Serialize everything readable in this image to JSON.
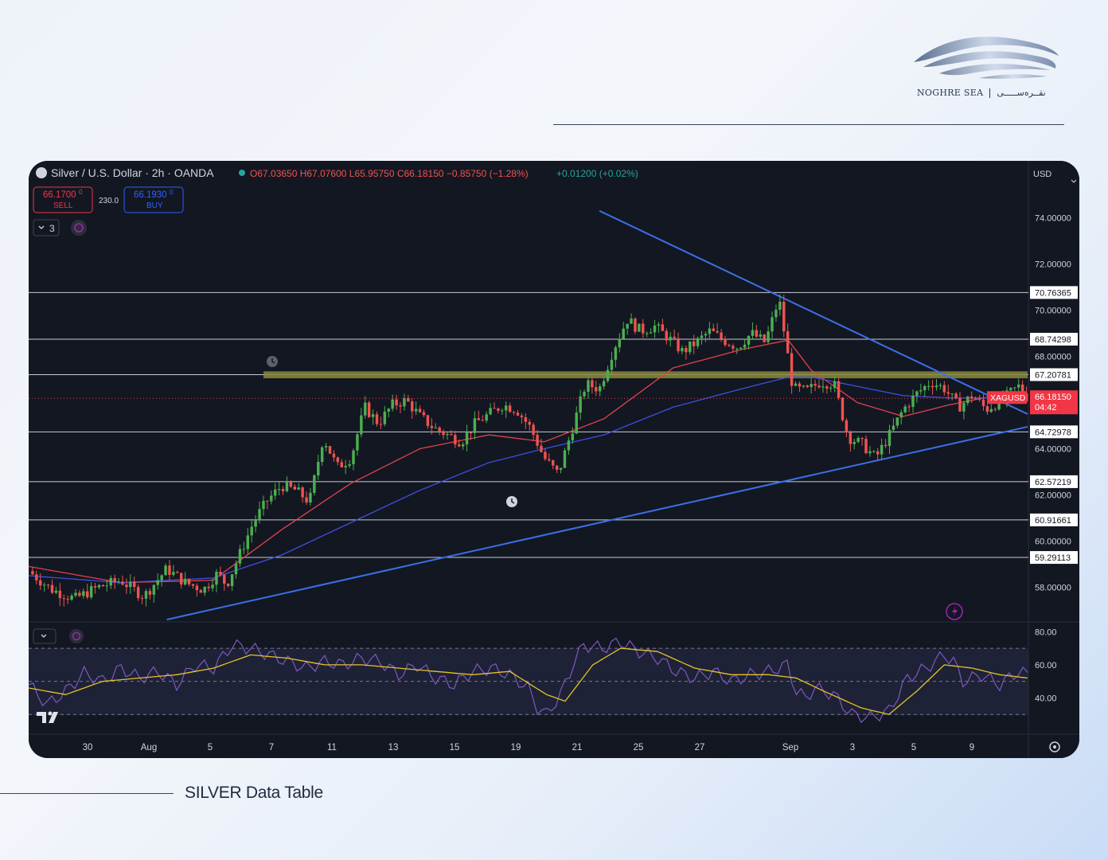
{
  "brand": {
    "latin": "NOGHRE SEA",
    "persian": "نقــره‌ســـــی"
  },
  "caption": "SILVER Data Table",
  "header": {
    "symbol_title": "Silver / U.S. Dollar · 2h · OANDA",
    "ohlc": "O67.03650 H67.07600 L65.95750 C66.18150 −0.85750 (−1.28%)",
    "change2": "+0.01200 (+0.02%)",
    "sell_price": "66.1700",
    "sell_sup": "0",
    "sell_label": "SELL",
    "spread": "230.0",
    "buy_price": "66.1930",
    "buy_sup": "0",
    "buy_label": "BUY",
    "indicator_count": "3",
    "currency": "USD"
  },
  "colors": {
    "bg": "#131722",
    "up": "#26a69a",
    "down": "#ef5350",
    "candle_up": "#4caf50",
    "ema_red": "#e0434b",
    "ema_blue": "#3d4fe0",
    "trendline": "#3b6fe6",
    "resistance_zone": "#8a8a3a",
    "rsi": "#7e57c2",
    "rsi_ma": "#e6c229",
    "last_price": "#f23645"
  },
  "chart_data": {
    "type": "candlestick",
    "title": "Silver / U.S. Dollar · 2h · OANDA",
    "ylim": [
      56.5,
      75.5
    ],
    "y_ticks": [
      "74.00000",
      "72.00000",
      "70.00000",
      "68.00000",
      "64.00000",
      "62.00000",
      "60.00000",
      "58.00000"
    ],
    "x_ticks": [
      "30",
      "Aug",
      "5",
      "7",
      "11",
      "13",
      "15",
      "19",
      "21",
      "25",
      "27",
      "Sep",
      "3",
      "5",
      "9"
    ],
    "horizontal_levels": [
      70.76365,
      68.74298,
      67.20781,
      64.72978,
      62.57219,
      60.91661,
      59.29113
    ],
    "level_labels": [
      "70.76365",
      "68.74298",
      "67.20781",
      "64.72978",
      "62.57219",
      "60.91661",
      "59.29113"
    ],
    "last_price": {
      "symbol": "XAGUSD",
      "value": "66.18150",
      "countdown": "04:42"
    },
    "price_path": [
      [
        0,
        58.7
      ],
      [
        5,
        57.9
      ],
      [
        10,
        57.5
      ],
      [
        15,
        58.0
      ],
      [
        20,
        58.3
      ],
      [
        25,
        57.6
      ],
      [
        30,
        58.8
      ],
      [
        34,
        58.2
      ],
      [
        38,
        57.9
      ],
      [
        41,
        58.6
      ],
      [
        43,
        58.1
      ],
      [
        46,
        59.5
      ],
      [
        49,
        60.9
      ],
      [
        52,
        61.8
      ],
      [
        55,
        62.4
      ],
      [
        58,
        62.2
      ],
      [
        61,
        61.7
      ],
      [
        64,
        64.5
      ],
      [
        67,
        63.2
      ],
      [
        70,
        63.6
      ],
      [
        73,
        65.8
      ],
      [
        76,
        65.1
      ],
      [
        79,
        65.9
      ],
      [
        82,
        66.1
      ],
      [
        85,
        65.4
      ],
      [
        88,
        64.9
      ],
      [
        91,
        64.6
      ],
      [
        94,
        64.3
      ],
      [
        97,
        65.1
      ],
      [
        100,
        65.5
      ],
      [
        103,
        65.9
      ],
      [
        106,
        65.7
      ],
      [
        109,
        64.9
      ],
      [
        112,
        63.6
      ],
      [
        115,
        62.9
      ],
      [
        118,
        64.8
      ],
      [
        121,
        66.8
      ],
      [
        124,
        66.6
      ],
      [
        127,
        68.3
      ],
      [
        130,
        69.6
      ],
      [
        133,
        69.1
      ],
      [
        136,
        69.3
      ],
      [
        139,
        68.8
      ],
      [
        142,
        68.2
      ],
      [
        145,
        68.6
      ],
      [
        148,
        69.1
      ],
      [
        151,
        68.7
      ],
      [
        154,
        68.4
      ],
      [
        157,
        69.0
      ],
      [
        160,
        68.6
      ],
      [
        163,
        70.5
      ],
      [
        166,
        66.6
      ],
      [
        169,
        66.5
      ],
      [
        172,
        66.9
      ],
      [
        175,
        66.8
      ],
      [
        178,
        64.5
      ],
      [
        181,
        64.2
      ],
      [
        184,
        63.6
      ],
      [
        187,
        64.6
      ],
      [
        190,
        65.7
      ],
      [
        193,
        66.4
      ],
      [
        196,
        66.9
      ],
      [
        199,
        66.6
      ],
      [
        202,
        65.8
      ],
      [
        205,
        66.3
      ],
      [
        208,
        65.7
      ],
      [
        212,
        66.2
      ],
      [
        215,
        66.7
      ],
      [
        217,
        66.18
      ]
    ],
    "ema_red": [
      [
        0,
        58.9
      ],
      [
        20,
        58.2
      ],
      [
        40,
        58.3
      ],
      [
        55,
        60.5
      ],
      [
        70,
        62.5
      ],
      [
        85,
        64.0
      ],
      [
        100,
        64.6
      ],
      [
        112,
        64.3
      ],
      [
        125,
        65.3
      ],
      [
        140,
        67.5
      ],
      [
        155,
        68.3
      ],
      [
        165,
        68.7
      ],
      [
        170,
        67.4
      ],
      [
        180,
        66.0
      ],
      [
        190,
        65.4
      ],
      [
        200,
        65.9
      ],
      [
        210,
        66.3
      ],
      [
        217,
        66.4
      ]
    ],
    "ema_blue": [
      [
        0,
        58.5
      ],
      [
        20,
        58.2
      ],
      [
        40,
        58.4
      ],
      [
        55,
        59.4
      ],
      [
        70,
        60.8
      ],
      [
        85,
        62.2
      ],
      [
        100,
        63.4
      ],
      [
        112,
        64.0
      ],
      [
        125,
        64.6
      ],
      [
        140,
        65.8
      ],
      [
        155,
        66.6
      ],
      [
        165,
        67.1
      ],
      [
        170,
        67.1
      ],
      [
        180,
        66.7
      ],
      [
        190,
        66.3
      ],
      [
        200,
        66.2
      ],
      [
        210,
        66.2
      ],
      [
        217,
        66.3
      ]
    ],
    "trendlines": [
      {
        "from": [
          124,
          74.3
        ],
        "to": [
          217,
          65.5
        ]
      },
      {
        "from": [
          30,
          56.6
        ],
        "to": [
          217,
          64.95
        ]
      }
    ],
    "resistance_zone": [
      67.05,
      67.35
    ],
    "rsi": {
      "ylim": [
        20,
        84
      ],
      "y_ticks": [
        "80.00",
        "60.00",
        "40.00"
      ],
      "bands": [
        70,
        50,
        30
      ],
      "rsi_path": [
        [
          0,
          48
        ],
        [
          4,
          36
        ],
        [
          8,
          44
        ],
        [
          12,
          55
        ],
        [
          16,
          50
        ],
        [
          20,
          58
        ],
        [
          24,
          52
        ],
        [
          28,
          56
        ],
        [
          32,
          48
        ],
        [
          36,
          60
        ],
        [
          40,
          58
        ],
        [
          44,
          72
        ],
        [
          48,
          70
        ],
        [
          52,
          66
        ],
        [
          56,
          62
        ],
        [
          60,
          58
        ],
        [
          64,
          62
        ],
        [
          68,
          60
        ],
        [
          72,
          64
        ],
        [
          76,
          62
        ],
        [
          80,
          54
        ],
        [
          84,
          60
        ],
        [
          88,
          52
        ],
        [
          92,
          48
        ],
        [
          96,
          56
        ],
        [
          100,
          58
        ],
        [
          104,
          54
        ],
        [
          108,
          46
        ],
        [
          110,
          34
        ],
        [
          112,
          30
        ],
        [
          115,
          42
        ],
        [
          118,
          62
        ],
        [
          120,
          72
        ],
        [
          124,
          70
        ],
        [
          128,
          74
        ],
        [
          132,
          68
        ],
        [
          136,
          64
        ],
        [
          140,
          56
        ],
        [
          144,
          52
        ],
        [
          148,
          56
        ],
        [
          152,
          50
        ],
        [
          156,
          54
        ],
        [
          160,
          56
        ],
        [
          164,
          60
        ],
        [
          166,
          44
        ],
        [
          168,
          40
        ],
        [
          170,
          46
        ],
        [
          174,
          42
        ],
        [
          178,
          30
        ],
        [
          182,
          28
        ],
        [
          186,
          32
        ],
        [
          190,
          52
        ],
        [
          194,
          58
        ],
        [
          198,
          66
        ],
        [
          200,
          62
        ],
        [
          202,
          50
        ],
        [
          206,
          54
        ],
        [
          210,
          48
        ],
        [
          214,
          56
        ],
        [
          216,
          54
        ]
      ],
      "ma_path": [
        [
          0,
          46
        ],
        [
          8,
          42
        ],
        [
          16,
          50
        ],
        [
          24,
          52
        ],
        [
          32,
          54
        ],
        [
          40,
          58
        ],
        [
          48,
          66
        ],
        [
          56,
          64
        ],
        [
          64,
          60
        ],
        [
          72,
          60
        ],
        [
          80,
          58
        ],
        [
          88,
          56
        ],
        [
          96,
          54
        ],
        [
          104,
          56
        ],
        [
          112,
          42
        ],
        [
          116,
          38
        ],
        [
          122,
          60
        ],
        [
          128,
          70
        ],
        [
          136,
          68
        ],
        [
          144,
          58
        ],
        [
          152,
          54
        ],
        [
          160,
          54
        ],
        [
          166,
          52
        ],
        [
          172,
          44
        ],
        [
          180,
          34
        ],
        [
          186,
          30
        ],
        [
          192,
          44
        ],
        [
          198,
          60
        ],
        [
          204,
          58
        ],
        [
          210,
          54
        ],
        [
          216,
          52
        ]
      ]
    }
  }
}
